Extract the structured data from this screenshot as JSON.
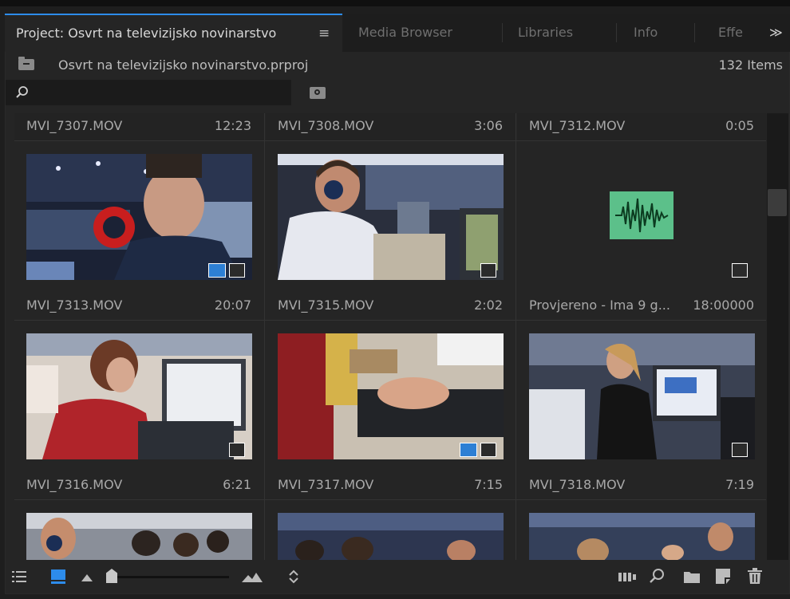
{
  "panel": {
    "tabs": [
      {
        "label": "Project: Osvrt na televizijsko novinarstvo",
        "active": true
      },
      {
        "label": "Media Browser",
        "active": false
      },
      {
        "label": "Libraries",
        "active": false
      },
      {
        "label": "Info",
        "active": false
      },
      {
        "label": "Effe",
        "active": false
      }
    ],
    "menu_glyph": "≡",
    "overflow_glyph": "≫"
  },
  "project": {
    "file": "Osvrt na televizijsko novinarstvo.prproj",
    "item_count": "132 Items"
  },
  "search": {
    "placeholder": ""
  },
  "items": [
    {
      "name": "MVI_7307.MOV",
      "duration": "12:23",
      "type": "header-only"
    },
    {
      "name": "MVI_7308.MOV",
      "duration": "3:06",
      "type": "header-only"
    },
    {
      "name": "MVI_7312.MOV",
      "duration": "0:05",
      "type": "audio"
    },
    {
      "name": "MVI_7313.MOV",
      "duration": "20:07",
      "type": "video"
    },
    {
      "name": "MVI_7315.MOV",
      "duration": "2:02",
      "type": "video"
    },
    {
      "name": "Provjereno - Ima 9 g...",
      "duration": "18:00000",
      "type": "video"
    },
    {
      "name": "MVI_7316.MOV",
      "duration": "6:21",
      "type": "video"
    },
    {
      "name": "MVI_7317.MOV",
      "duration": "7:15",
      "type": "video"
    },
    {
      "name": "MVI_7318.MOV",
      "duration": "7:19",
      "type": "video"
    }
  ],
  "colors": {
    "accent": "#2d8ceb",
    "audio_waveform_bg": "#5cc08a",
    "panel_bg": "#252525",
    "tab_bar_bg": "#1d1d1d"
  },
  "toolbar": {
    "icons": [
      "list-view-icon",
      "icon-view-icon",
      "zoom-out-icon",
      "zoom-slider",
      "zoom-in-icon",
      "sort-icon",
      "automate-to-sequence-icon",
      "find-icon",
      "new-bin-icon",
      "new-item-icon",
      "trash-icon"
    ]
  }
}
